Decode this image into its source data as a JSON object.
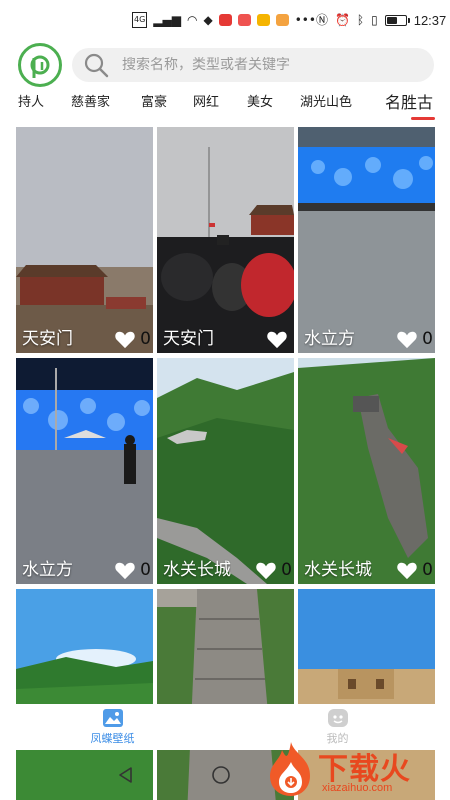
{
  "status_bar": {
    "network": "4G",
    "time": "12:37",
    "battery_level": 0.6
  },
  "header": {
    "logo_icon": "app-logo-icon",
    "search_placeholder": "搜索名称，类型或者关键字"
  },
  "tabs": {
    "items": [
      "持人",
      "慈善家",
      "富豪",
      "网红",
      "美女",
      "湖光山色",
      "名胜古"
    ],
    "active_index": 6,
    "active_color": "#e53935"
  },
  "tiles": [
    {
      "title": "天安门",
      "likes": "0",
      "scene": "tiananmen-dusk"
    },
    {
      "title": "天安门",
      "likes": "",
      "scene": "tiananmen-crowd"
    },
    {
      "title": "水立方",
      "likes": "0",
      "scene": "water-cube-plaza"
    },
    {
      "title": "水立方",
      "likes": "0",
      "scene": "water-cube-night"
    },
    {
      "title": "水关长城",
      "likes": "0",
      "scene": "great-wall-valley"
    },
    {
      "title": "水关长城",
      "likes": "0",
      "scene": "great-wall-ridge"
    },
    {
      "title": "",
      "likes": "",
      "scene": "green-hills"
    },
    {
      "title": "",
      "likes": "",
      "scene": "great-wall-stairs"
    },
    {
      "title": "",
      "likes": "",
      "scene": "watchtower"
    }
  ],
  "bottom_nav": {
    "items": [
      {
        "label": "凤蝶壁纸",
        "icon": "image-icon",
        "active": true
      },
      {
        "label": "我的",
        "icon": "profile-icon",
        "active": false
      }
    ],
    "active_color": "#3c8de6"
  },
  "watermark": {
    "text": "下载火",
    "url_text": "xiazaihuo.com"
  }
}
